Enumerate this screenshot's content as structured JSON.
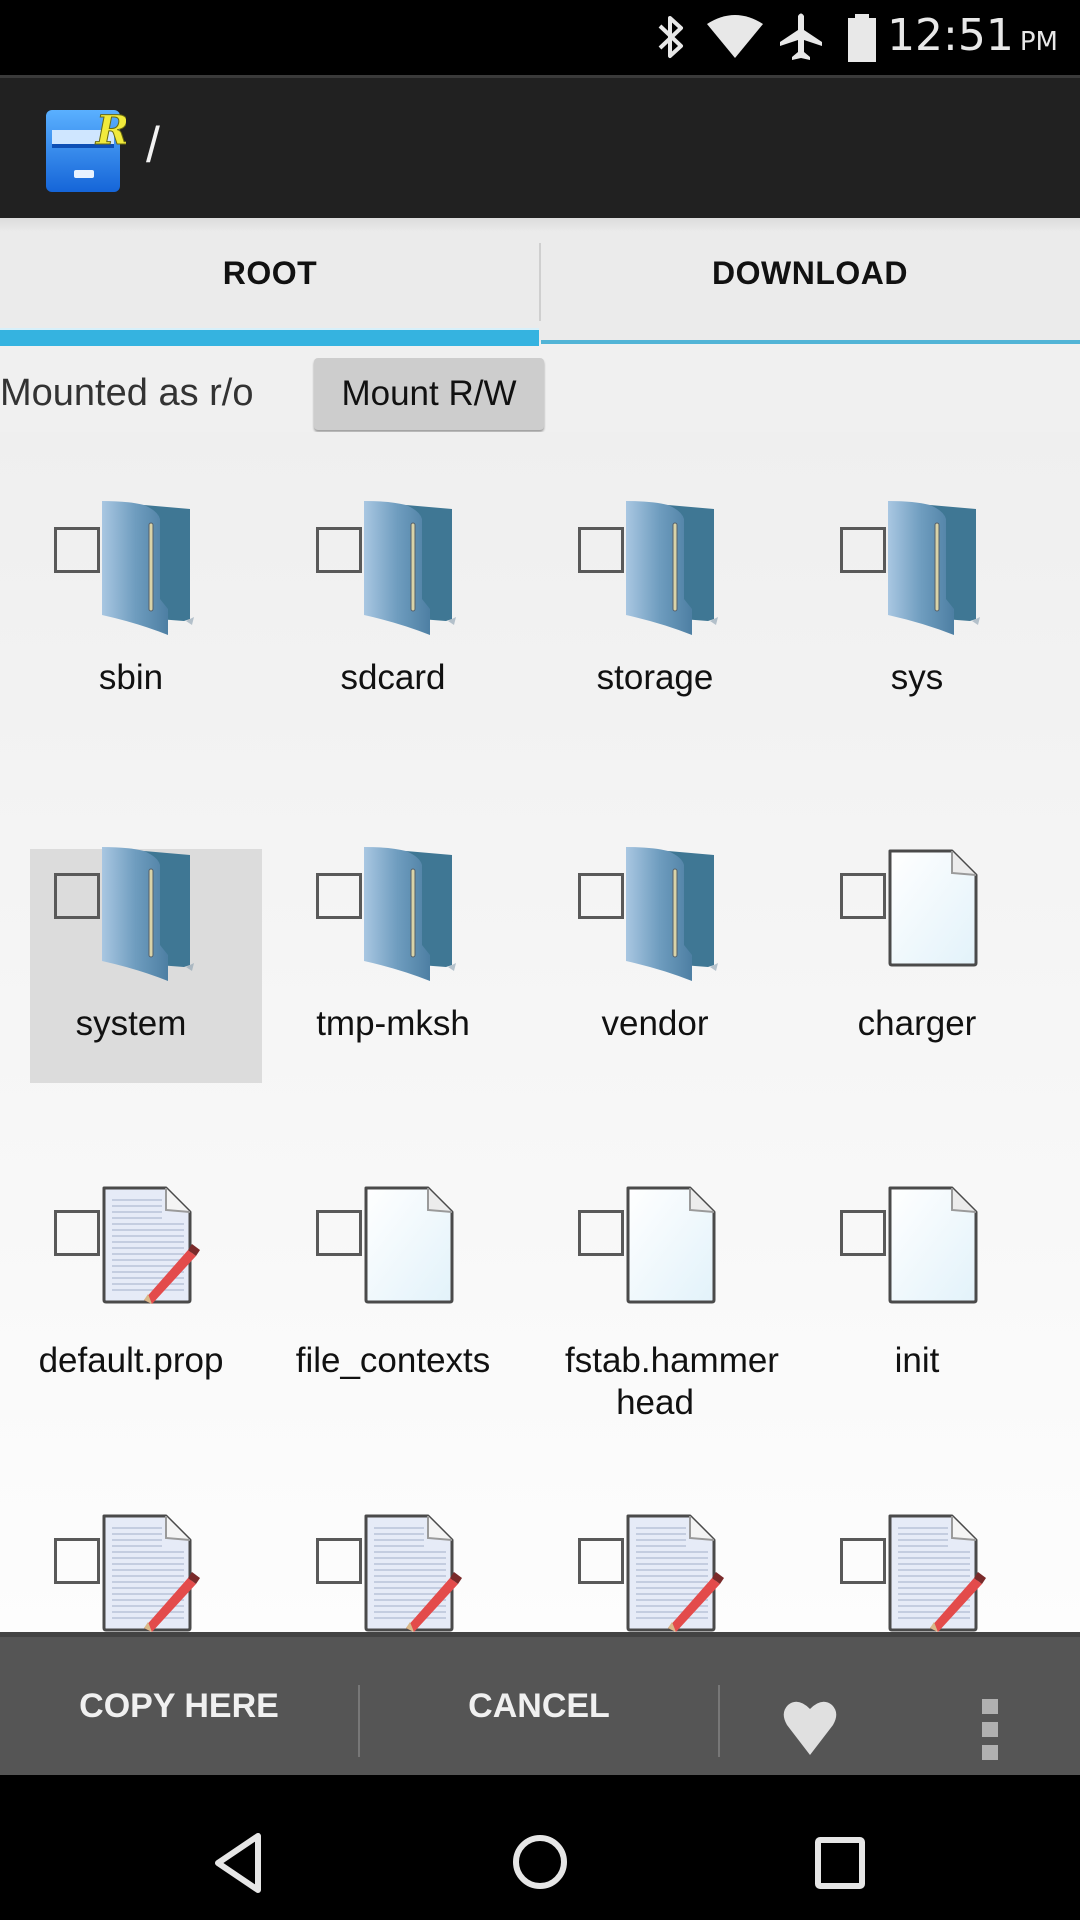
{
  "status_bar": {
    "icons": [
      "bluetooth-icon",
      "wifi-icon",
      "airplane-mode-icon",
      "battery-icon"
    ],
    "time": "12:51",
    "ampm": "PM"
  },
  "app_bar": {
    "logo": "root-explorer-logo",
    "path": "/"
  },
  "tabs": [
    {
      "label": "ROOT",
      "active": true
    },
    {
      "label": "DOWNLOAD",
      "active": false
    }
  ],
  "colors": {
    "accent": "#35b3e0",
    "status_bar_bg": "#000000",
    "app_bar_bg": "#212121",
    "action_bar_bg": "#555555",
    "selected_item_bg": "#dcdcdc"
  },
  "mount": {
    "status": "Mounted as r/o",
    "button_label": "Mount R/W"
  },
  "files": [
    {
      "name": "sbin",
      "type": "folder",
      "selected": false
    },
    {
      "name": "sdcard",
      "type": "folder",
      "selected": false
    },
    {
      "name": "storage",
      "type": "folder",
      "selected": false
    },
    {
      "name": "sys",
      "type": "folder",
      "selected": false
    },
    {
      "name": "system",
      "type": "folder",
      "selected": true
    },
    {
      "name": "tmp-mksh",
      "type": "folder",
      "selected": false
    },
    {
      "name": "vendor",
      "type": "folder",
      "selected": false
    },
    {
      "name": "charger",
      "type": "file",
      "selected": false
    },
    {
      "name": "default.prop",
      "type": "text",
      "selected": false
    },
    {
      "name": "file_contexts",
      "type": "file",
      "selected": false
    },
    {
      "name": "fstab.hammer head",
      "type": "file",
      "selected": false
    },
    {
      "name": "init",
      "type": "file",
      "selected": false
    },
    {
      "name": "",
      "type": "text",
      "selected": false
    },
    {
      "name": "",
      "type": "text",
      "selected": false
    },
    {
      "name": "",
      "type": "text",
      "selected": false
    },
    {
      "name": "",
      "type": "text",
      "selected": false
    }
  ],
  "action_bar": {
    "copy_here": "COPY HERE",
    "cancel": "CANCEL",
    "favorite_icon": "heart-icon",
    "overflow_icon": "more-vert-icon"
  },
  "nav_bar": {
    "back": "back-icon",
    "home": "home-icon",
    "recents": "recents-icon"
  }
}
